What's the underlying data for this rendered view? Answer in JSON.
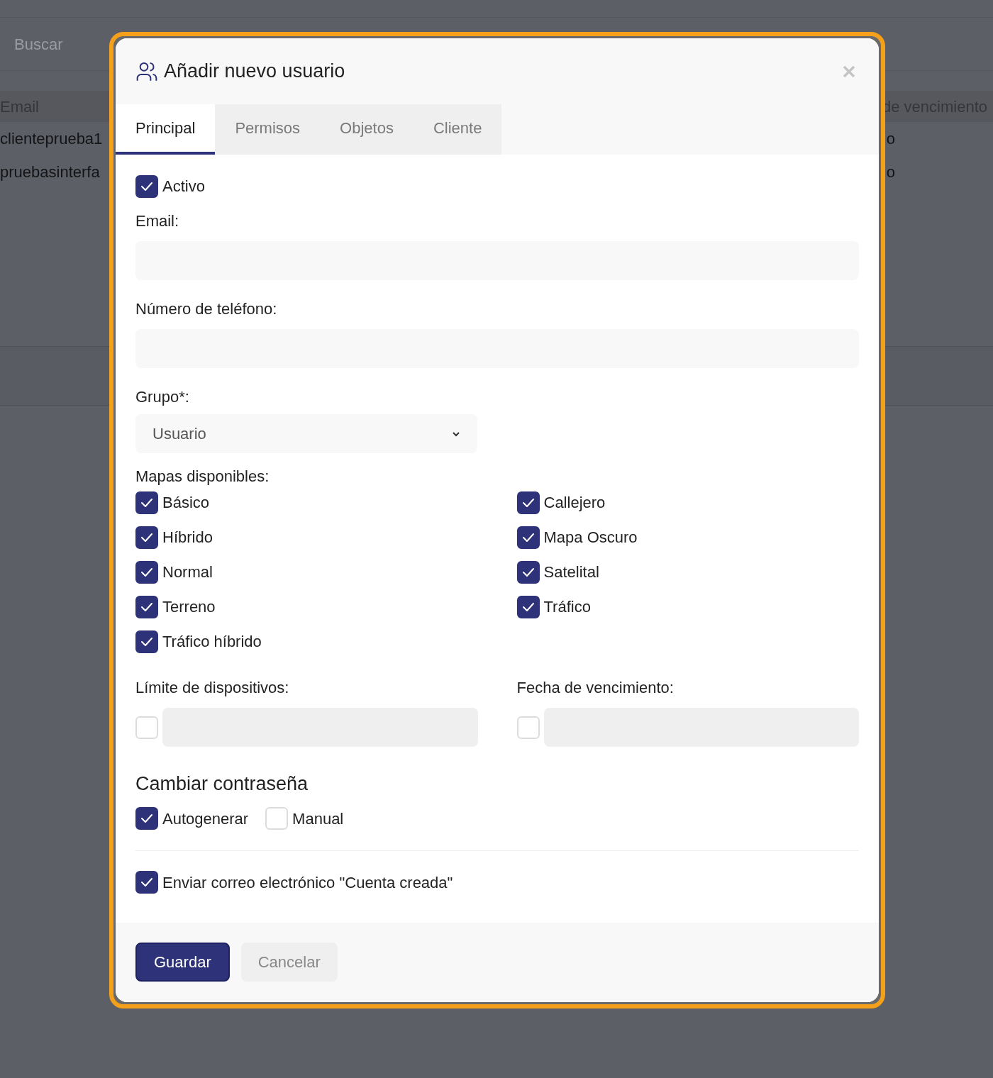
{
  "background": {
    "search": {
      "placeholder": "Buscar"
    },
    "table": {
      "columns": [
        "Email",
        "de vencimiento"
      ],
      "rows": [
        [
          "clienteprueba1",
          "o"
        ],
        [
          "pruebasinterfa",
          "o"
        ]
      ]
    }
  },
  "dialog": {
    "title": "Añadir nuevo usuario",
    "tabs": [
      {
        "label": "Principal",
        "selected": true
      },
      {
        "label": "Permisos",
        "selected": false
      },
      {
        "label": "Objetos",
        "selected": false
      },
      {
        "label": "Cliente",
        "selected": false
      }
    ],
    "active": {
      "label": "Activo",
      "checked": true
    },
    "email": {
      "label": "Email:"
    },
    "phone": {
      "label": "Número de teléfono:"
    },
    "group": {
      "label": "Grupo*:",
      "value": "Usuario"
    },
    "maps": {
      "label": "Mapas disponibles:",
      "columns": [
        [
          {
            "label": "Básico",
            "checked": true
          },
          {
            "label": "Híbrido",
            "checked": true
          },
          {
            "label": "Normal",
            "checked": true
          },
          {
            "label": "Terreno",
            "checked": true
          },
          {
            "label": "Tráfico híbrido",
            "checked": true
          }
        ],
        [
          {
            "label": "Callejero",
            "checked": true
          },
          {
            "label": "Mapa Oscuro",
            "checked": true
          },
          {
            "label": "Satelital",
            "checked": true
          },
          {
            "label": "Tráfico",
            "checked": true
          }
        ]
      ]
    },
    "device_limit": {
      "label": "Límite de dispositivos:",
      "checked": false,
      "disabled": true
    },
    "expiry": {
      "label": "Fecha de vencimiento:",
      "checked": false,
      "disabled": true
    },
    "password": {
      "heading": "Cambiar contraseña",
      "options": [
        {
          "label": "Autogenerar",
          "checked": true
        },
        {
          "label": "Manual",
          "checked": false
        }
      ]
    },
    "send_email": {
      "label": "Enviar correo electrónico \"Cuenta creada\"",
      "checked": true
    },
    "buttons": [
      {
        "label": "Guardar",
        "kind": "primary"
      },
      {
        "label": "Cancelar",
        "kind": "secondary"
      }
    ]
  }
}
